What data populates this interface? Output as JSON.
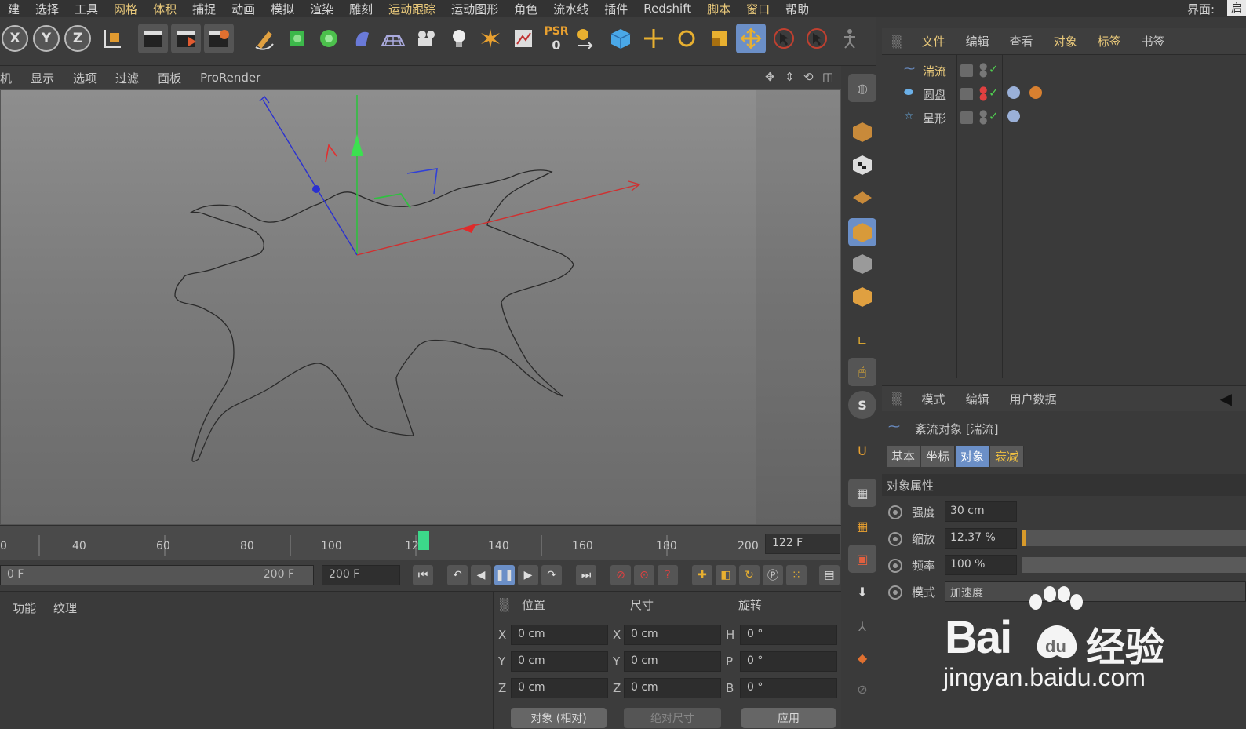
{
  "menu": {
    "items": [
      "建",
      "选择",
      "工具",
      "网格",
      "体积",
      "捕捉",
      "动画",
      "模拟",
      "渲染",
      "雕刻",
      "运动跟踪",
      "运动图形",
      "角色",
      "流水线",
      "插件",
      "Redshift",
      "脚本",
      "窗口",
      "帮助"
    ],
    "right_label": "界面:",
    "right_box": "启"
  },
  "toolbar": {
    "x_label": "X",
    "y_label": "Y",
    "z_label": "Z",
    "psr_label": "PSR",
    "psr_value": "0"
  },
  "viewport_menu": [
    "机",
    "显示",
    "选项",
    "过滤",
    "面板",
    "ProRender"
  ],
  "timeline": {
    "ticks": [
      "0",
      "40",
      "60",
      "80",
      "100",
      "12",
      "140",
      "160",
      "180",
      "200"
    ],
    "current_frame": "122 F",
    "progress_fraction": 0.61
  },
  "transport": {
    "start": "0 F",
    "range_end": "200 F",
    "end_field": "200 F"
  },
  "material": {
    "tabs": [
      "功能",
      "纹理"
    ]
  },
  "coords": {
    "headers": {
      "position": "位置",
      "size": "尺寸",
      "rotation": "旋转"
    },
    "rows": [
      {
        "pos_label": "X",
        "pos": "0 cm",
        "size_label": "X",
        "size": "0 cm",
        "rot_label": "H",
        "rot": "0 °"
      },
      {
        "pos_label": "Y",
        "pos": "0 cm",
        "size_label": "Y",
        "size": "0 cm",
        "rot_label": "P",
        "rot": "0 °"
      },
      {
        "pos_label": "Z",
        "pos": "0 cm",
        "size_label": "Z",
        "size": "0 cm",
        "rot_label": "B",
        "rot": "0 °"
      }
    ],
    "buttons": {
      "mode": "对象 (相对)",
      "size_mode": "绝对尺寸",
      "apply": "应用"
    }
  },
  "object_manager": {
    "menu": [
      "文件",
      "编辑",
      "查看",
      "对象",
      "标签",
      "书签"
    ],
    "objects": [
      {
        "name": "湍流",
        "selected": true
      },
      {
        "name": "圆盘",
        "selected": false
      },
      {
        "name": "星形",
        "selected": false
      }
    ]
  },
  "attributes": {
    "menu": [
      "模式",
      "编辑",
      "用户数据"
    ],
    "title": "紊流对象 [湍流]",
    "tabs": [
      "基本",
      "坐标",
      "对象",
      "衰减"
    ],
    "section": "对象属性",
    "props": [
      {
        "label": "强度",
        "value": "30 cm"
      },
      {
        "label": "缩放",
        "value": "12.37 %",
        "fraction": 0.02
      },
      {
        "label": "频率",
        "value": "100 %"
      },
      {
        "label": "模式",
        "value": "加速度"
      }
    ]
  },
  "watermark": {
    "brand": "Bai",
    "brand2": "经验",
    "url": "jingyan.baidu.com"
  },
  "colors": {
    "accent": "#e8c87a",
    "active_tab": "#6b8fc7",
    "playhead": "#3cd88a",
    "slider_fill": "#d89a2a"
  }
}
